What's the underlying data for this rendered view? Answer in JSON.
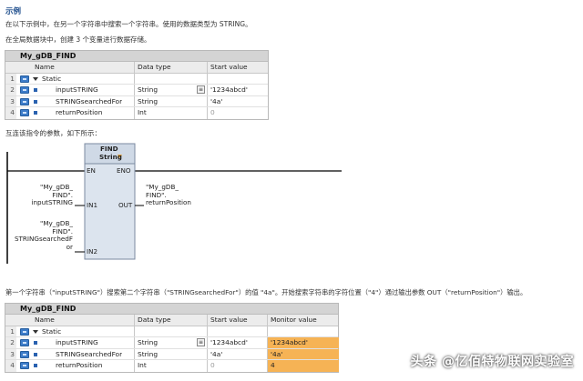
{
  "heading": "示例",
  "intro_1": "在以下示例中，在另一个字符串中搜索一个字符串。使用的数据类型为 STRING。",
  "intro_2": "在全局数据块中，创建 3 个变量进行数据存储。",
  "table1": {
    "title": "My_gDB_FIND",
    "columns": [
      "Name",
      "Data type",
      "Start value"
    ],
    "rows": [
      {
        "num": "1",
        "name": "Static",
        "type": "",
        "start": ""
      },
      {
        "num": "2",
        "name": "inputSTRING",
        "type": "String",
        "start": "'1234abcd'"
      },
      {
        "num": "3",
        "name": "STRINGsearchedFor",
        "type": "String",
        "start": "'4a'"
      },
      {
        "num": "4",
        "name": "returnPosition",
        "type": "Int",
        "start": "0"
      }
    ]
  },
  "connect_text": "互连该指令的参数，如下所示：",
  "block": {
    "title_1": "FIND",
    "title_2": "String",
    "en": "EN",
    "eno": "ENO",
    "in1": "IN1",
    "in2": "IN2",
    "out": "OUT",
    "in1_operand": [
      "\"My_gDB_",
      "FIND\".",
      "inputSTRING"
    ],
    "in2_operand": [
      "\"My_gDB_",
      "FIND\".",
      "STRINGsearchedF",
      "or"
    ],
    "out_operand": [
      "\"My_gDB_",
      "FIND\".",
      "returnPosition"
    ]
  },
  "result_text": "第一个字符串（\"inputSTRING\"）搜索第二个字符串（\"STRINGsearchedFor\"）的值 \"4a\"。开始搜索字符串的字符位置（\"4\"）通过输出参数 OUT（\"returnPosition\"）输出。",
  "table2": {
    "title": "My_gDB_FIND",
    "columns": [
      "Name",
      "Data type",
      "Start value",
      "Monitor value"
    ],
    "rows": [
      {
        "num": "1",
        "name": "Static",
        "type": "",
        "start": "",
        "monitor": ""
      },
      {
        "num": "2",
        "name": "inputSTRING",
        "type": "String",
        "start": "'1234abcd'",
        "monitor": "'1234abcd'"
      },
      {
        "num": "3",
        "name": "STRINGsearchedFor",
        "type": "String",
        "start": "'4a'",
        "monitor": "'4a'"
      },
      {
        "num": "4",
        "name": "returnPosition",
        "type": "Int",
        "start": "0",
        "monitor": "4"
      }
    ]
  },
  "watermark": "头条 @亿佰特物联网实验室",
  "colors": {
    "monitor_highlight": "#f6b355",
    "heading": "#1a4a8a",
    "db_icon": "#3d7cc9"
  }
}
